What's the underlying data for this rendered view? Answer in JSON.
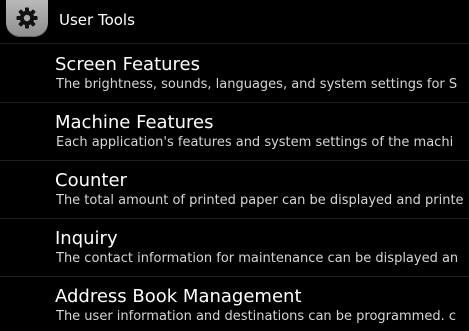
{
  "header": {
    "title": "User Tools",
    "icon": "gear-icon"
  },
  "items": [
    {
      "title": "Screen Features",
      "description": "The brightness, sounds, languages, and system settings for S"
    },
    {
      "title": "Machine Features",
      "description": "Each application's features and system settings of the machi"
    },
    {
      "title": "Counter",
      "description": "The total amount of printed paper can be displayed and printe"
    },
    {
      "title": "Inquiry",
      "description": "The contact information for maintenance can be displayed an"
    },
    {
      "title": "Address Book Management",
      "description": "The user information and destinations can be programmed. c"
    }
  ],
  "colors": {
    "background": "#000000",
    "text": "#ffffff",
    "description_text": "#d6d6d6",
    "gear_tab": "#a8a8a8"
  }
}
